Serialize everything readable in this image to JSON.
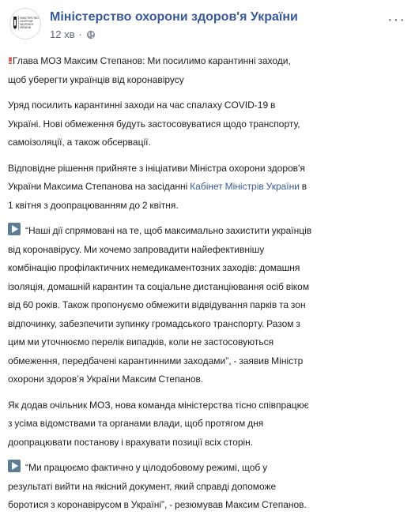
{
  "header": {
    "page_name": "Міністерство охорони здоров'я України",
    "time": "12 хв",
    "separator": "·",
    "privacy_icon": "globe-icon",
    "more_icon": "more-options-icon",
    "avatar_text": [
      "МІНІСТЕРСТВО",
      "ОХОРОНИ",
      "ЗДОРОВ'Я",
      "УКРАЇНИ"
    ]
  },
  "post": {
    "title_icon": "double-exclamation-icon",
    "title_lines": [
      "Глава МОЗ Максим Степанов: Ми посилимо карантинні заходи,",
      "щоб уберегти українців від коронавірусу"
    ],
    "p1_lines": [
      "Уряд посилить карантинні заходи на час спалаху COVID-19 в",
      "Україні. Нові обмеження будуть застосовуватися щодо транспорту,",
      "самоізоляції, а також обсервації."
    ],
    "p2": {
      "line1": "Відповідне рішення прийняте з ініціативи Міністра охорони здоров'я",
      "line2_before": "України Максима Степанова на засіданні ",
      "line2_link": "Кабінет Міністрів України",
      "line2_after": " в",
      "line3": "1 квітня з доопрацюванням до 2 квітня."
    },
    "quote_icon": "play-button-icon",
    "p3_lines": [
      "“Наші дії спрямовані на те, щоб максимально захистити українців",
      "від коронавірусу. Ми хочемо запровадити найефективнішу",
      "комбінацію профілактичних немедикаментозних заходів: домашня",
      "ізоляція, домашній карантин та соціальне дистанціювання осіб віком",
      "від 60 років. Також пропонуємо обмежити відвідування парків та зон",
      "відпочинку, забезпечити зупинку громадського транспорту. Разом з",
      "цим ми уточнюємо перелік випадків, коли не застосовуються",
      "обмеження, передбачені карантинними заходами”, - заявив Міністр",
      "охорони здоров’я України Максим Степанов."
    ],
    "p4_lines": [
      "Як додав очільник МОЗ, нова команда міністерства тісно співпрацює",
      "з усіма відомствами та органами влади, щоб протягом дня",
      "доопрацювати постанову і врахувати позиції всіх сторін."
    ],
    "p5_lines": [
      "“Ми працюємо фактично у цілодобовому режимі, щоб у",
      "результаті вийти на якісний документ, який справді допоможе",
      "боротися з коронавірусом в Україні”, - резюмував Максим Степанов."
    ]
  }
}
